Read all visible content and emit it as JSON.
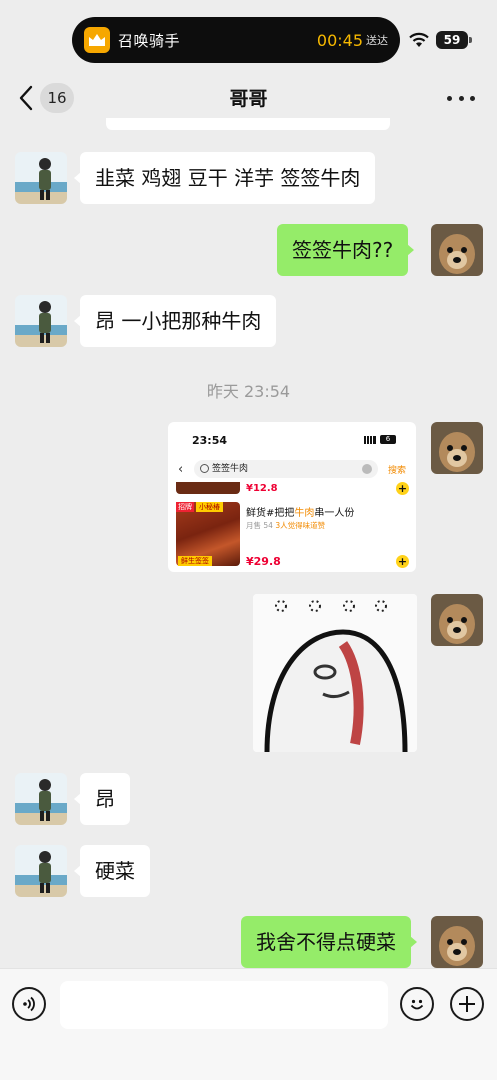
{
  "status_bar": {
    "app_name": "召唤骑手",
    "timer": "00:45",
    "timer_suffix": "送达",
    "battery": "59"
  },
  "header": {
    "unread_count": "16",
    "title": "哥哥"
  },
  "messages": [
    {
      "side": "left",
      "text": "韭菜 鸡翅 豆干 洋芋  签签牛肉"
    },
    {
      "side": "right",
      "text": "签签牛肉??"
    },
    {
      "side": "left",
      "text": "昂 一小把那种牛肉"
    },
    {
      "side": "left",
      "text": "昂"
    },
    {
      "side": "left",
      "text": "硬菜"
    },
    {
      "side": "right",
      "text": "我舍不得点硬菜"
    }
  ],
  "timestamp": "昨天 23:54",
  "shared_screenshot": {
    "time": "23:54",
    "battery": "6",
    "search_query": "签签牛肉",
    "search_button": "搜索",
    "item1_price": "¥12.8",
    "item2_tag": "招牌",
    "item2_shop_tag": "小秘椿",
    "item2_bottom_tag": "鲜生签签",
    "item2_name_pre": "鲜货#把把",
    "item2_name_hl": "牛肉",
    "item2_name_post": "串一人份",
    "item2_sales": "月售 54",
    "item2_sales_hl": "3人觉得味道赞",
    "item2_price": "¥29.8",
    "plus": "+"
  },
  "input": {
    "placeholder": ""
  },
  "colors": {
    "chat_bg": "#ededed",
    "sent_bubble": "#95ec69",
    "received_bubble": "#ffffff",
    "timer": "#f6b800"
  },
  "icons": [
    "back-chevron-icon",
    "more-icon",
    "voice-icon",
    "emoji-icon",
    "add-icon",
    "wifi-icon",
    "battery-icon",
    "rider-app-icon"
  ]
}
